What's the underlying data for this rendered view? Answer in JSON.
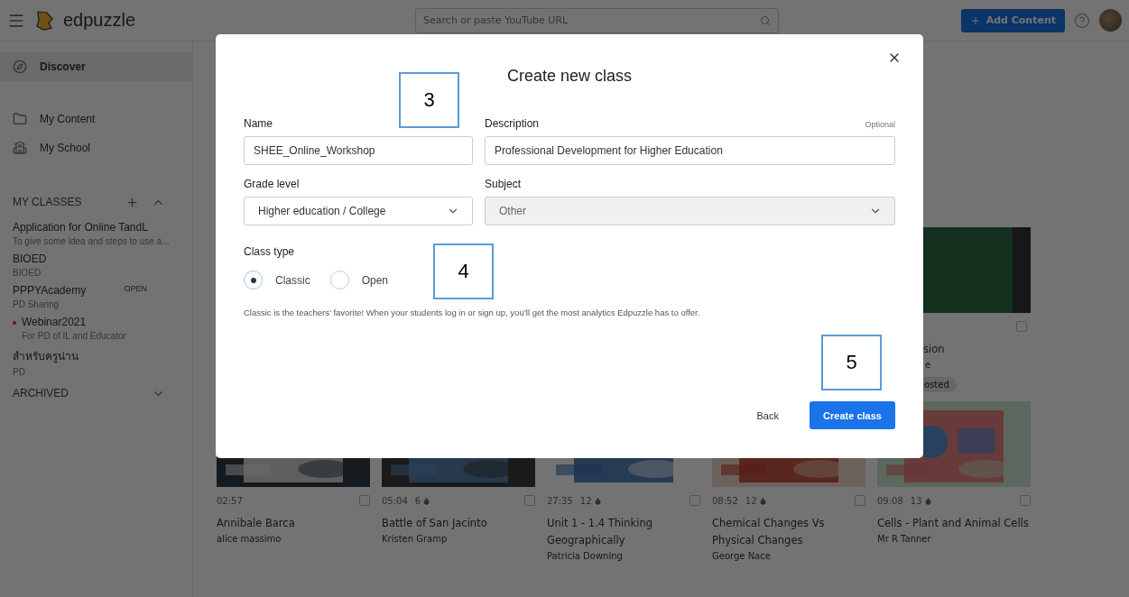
{
  "top_bar": {
    "logo": "edpuzzle",
    "search": {
      "placeholder": "Search or paste YouTube URL"
    },
    "add_button": {
      "label": "Add Content"
    }
  },
  "sidebar": {
    "nav": [
      {
        "label": "Discover",
        "selected": true
      },
      {
        "label": "My Content",
        "selected": false
      },
      {
        "label": "My School",
        "selected": false
      }
    ],
    "classes_header": "MY CLASSES",
    "classes": [
      {
        "name": "Application for Online TandL",
        "subtitle": "To give some idea and steps to use a...",
        "new_dot": false
      },
      {
        "name": "BIOED",
        "subtitle": "BIOED",
        "new_dot": false
      },
      {
        "name": "PPPYAcademy",
        "subtitle": "PD Sharing",
        "tag": "OPEN",
        "new_dot": false
      },
      {
        "name": "Webinar2021",
        "subtitle": "For PD of IL and Educator",
        "new_dot": true
      },
      {
        "name": "สำหรับครูน่าน",
        "subtitle": "PD",
        "new_dot": false
      }
    ],
    "archived": "ARCHIVED"
  },
  "top_card": {
    "title": "sion",
    "author": "e",
    "badge": "osted",
    "checked": false
  },
  "cards": [
    {
      "duration": "02:57",
      "title": "Annibale Barca",
      "author": "alice massimo",
      "checked": false
    },
    {
      "duration": "05:04",
      "count": "6",
      "title": "Battle of San Jacinto",
      "author": "Kristen Gramp",
      "checked": false
    },
    {
      "duration": "27:35",
      "count": "12",
      "title": "Unit 1 - 1.4 Thinking Geographically",
      "author": "Patricia Downing",
      "checked": false
    },
    {
      "duration": "08:52",
      "count": "12",
      "title": "Chemical Changes Vs Physical Changes",
      "author": "George Nace",
      "checked": false
    },
    {
      "duration": "09:08",
      "count": "13",
      "title": "Cells - Plant and Animal Cells",
      "author": "Mr R Tanner",
      "checked": false
    }
  ],
  "modal": {
    "title": "Create new class",
    "name": {
      "label": "Name",
      "value": "SHEE_Online_Workshop"
    },
    "description": {
      "label": "Description",
      "optional": "Optional",
      "value": "Professional Development for Higher Education"
    },
    "grade": {
      "label": "Grade level",
      "value": "Higher education / College",
      "disabled": false
    },
    "subject": {
      "label": "Subject",
      "value": "Other",
      "disabled": true
    },
    "class_type": {
      "label": "Class type",
      "options": [
        {
          "label": "Classic",
          "selected": true
        },
        {
          "label": "Open",
          "selected": false
        }
      ],
      "help": "Classic is the teachers’ favorite! When your students log in or sign up, you’ll get the most analytics Edpuzzle has to offer."
    },
    "back": "Back",
    "create": "Create class"
  },
  "callouts": [
    "3",
    "4",
    "5"
  ]
}
